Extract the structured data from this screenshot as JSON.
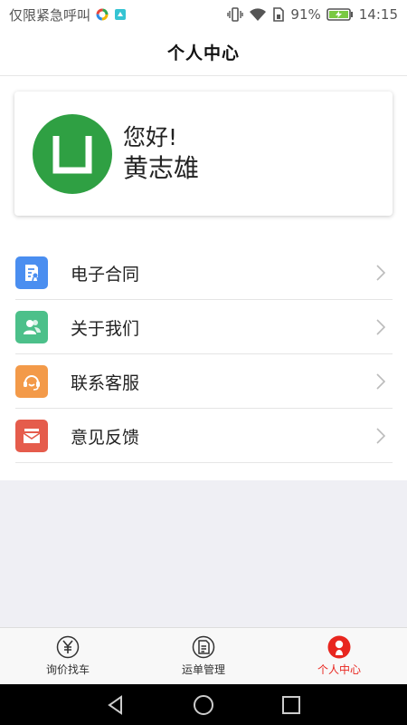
{
  "status_bar": {
    "carrier_text": "仅限紧急呼叫",
    "battery": "91%",
    "time": "14:15"
  },
  "header": {
    "title": "个人中心"
  },
  "profile": {
    "greeting": "您好!",
    "name": "黄志雄",
    "avatar_color": "#2fa043"
  },
  "menu": {
    "items": [
      {
        "label": "电子合同",
        "icon": "contract-icon",
        "color": "#4a8ef0"
      },
      {
        "label": "关于我们",
        "icon": "people-icon",
        "color": "#4cc08a"
      },
      {
        "label": "联系客服",
        "icon": "headset-icon",
        "color": "#f39a49"
      },
      {
        "label": "意见反馈",
        "icon": "feedback-mail-icon",
        "color": "#e55c4c"
      }
    ]
  },
  "tab_bar": {
    "tabs": [
      {
        "label": "询价找车",
        "icon": "yen-icon",
        "active": false
      },
      {
        "label": "运单管理",
        "icon": "document-icon",
        "active": false
      },
      {
        "label": "个人中心",
        "icon": "person-icon",
        "active": true
      }
    ],
    "active_color": "#e8261f"
  }
}
